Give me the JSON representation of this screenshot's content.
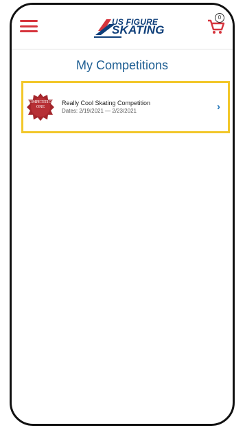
{
  "app": {
    "logo_text_top": "US FIGURE",
    "logo_text_bottom": "SKATING"
  },
  "header": {
    "cart_count": "0"
  },
  "page": {
    "title": "My Competitions"
  },
  "competitions": [
    {
      "badge_text_top": "COMPETITION",
      "badge_text_bottom": "ONE",
      "title": "Really Cool Skating Competition",
      "dates": "Dates: 2/19/2021 — 2/23/2021"
    }
  ],
  "colors": {
    "accent_red": "#d6343d",
    "brand_blue": "#1f5f93",
    "highlight_yellow": "#f2c72a"
  }
}
